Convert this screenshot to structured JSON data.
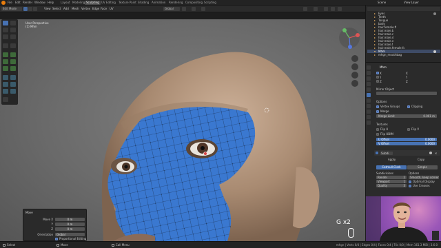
{
  "app": {
    "name": "Blender",
    "accent": "#e87d0d"
  },
  "topbar": {
    "menus": [
      "File",
      "Edit",
      "Render",
      "Window",
      "Help"
    ],
    "tabs": [
      "Layout",
      "Modeling",
      "Sculpting",
      "UV Editing",
      "Texture Paint",
      "Shading",
      "Animation",
      "Rendering",
      "Compositing",
      "Scripting"
    ],
    "active_tab": "Sculpting",
    "scene_label": "Scene",
    "view_layer_label": "View Layer"
  },
  "header": {
    "mode": "Edit Mode",
    "menus": [
      "View",
      "Select",
      "Add",
      "Mesh",
      "Vertex",
      "Edge",
      "Face",
      "UV"
    ],
    "transform": "Global"
  },
  "viewport": {
    "overlay_line1": "User Perspective",
    "overlay_line2": "(1) Mhm",
    "key_hint": "G x2"
  },
  "redo_panel": {
    "title": "Move",
    "rows": [
      {
        "label": "Move X",
        "value": "0 m"
      },
      {
        "label": "Y",
        "value": "0 m"
      },
      {
        "label": "Z",
        "value": "0 m"
      }
    ],
    "orientation_label": "Orientation",
    "orientation_value": "Global",
    "proportional": "Proportional Editing"
  },
  "outliner": {
    "rows": [
      "Eyes",
      "Teeth",
      "Tongue",
      "body",
      "hair.female.ff",
      "hair.male.b",
      "hair.male.c",
      "hair.male.d",
      "hair.male.e",
      "hair.male.f",
      "hair.male.female.fc",
      "Mhm",
      "mhgn_mouthbag"
    ],
    "selected_index": 11
  },
  "properties": {
    "object_name": "Mhm",
    "axis_labels": [
      "X",
      "Y",
      "Z"
    ],
    "mirror_object_label": "Mirror Object",
    "options_label": "Options",
    "vertex_groups": "Vertex Groups",
    "clipping": "Clipping",
    "merge": "Merge",
    "merge_limit_label": "Merge Limit",
    "merge_limit_value": "0.001 m",
    "textures_label": "Textures",
    "flip_u": "Flip U",
    "flip_v": "Flip V",
    "flip_udim": "Flip UDIM",
    "u_offset_label": "U Offset",
    "u_offset_value": "0.0000",
    "v_offset_label": "V Offset",
    "v_offset_value": "0.0000",
    "subdiv_name": "Subdi",
    "catmull_clark": "Catmull-Clark",
    "simple": "Simple",
    "levels_label": "Subdivisions",
    "render_label": "Render",
    "render_value": "2",
    "viewport_label": "Viewport",
    "viewport_value": "1",
    "quality_label": "Quality",
    "quality_value": "3",
    "options2_label": "Options",
    "uv_smooth": "Smooth, keep corners",
    "optimal_display": "Optimal Display",
    "use_creases": "Use Creases",
    "tab_apply": "Apply",
    "tab_copy": "Copy"
  },
  "status": {
    "left": "Select",
    "middle": "Move",
    "right_hint": "Call Menu",
    "stats": "mhgn | Verts 0/4 | Edges 0/4 | Faces 0/4 | Tris 0/0 | Mem 161.3 MiB | 3.6.0"
  },
  "colors": {
    "selection": "#3a78d0",
    "skin": "#b89a82",
    "panel": "#2b2b2b"
  }
}
